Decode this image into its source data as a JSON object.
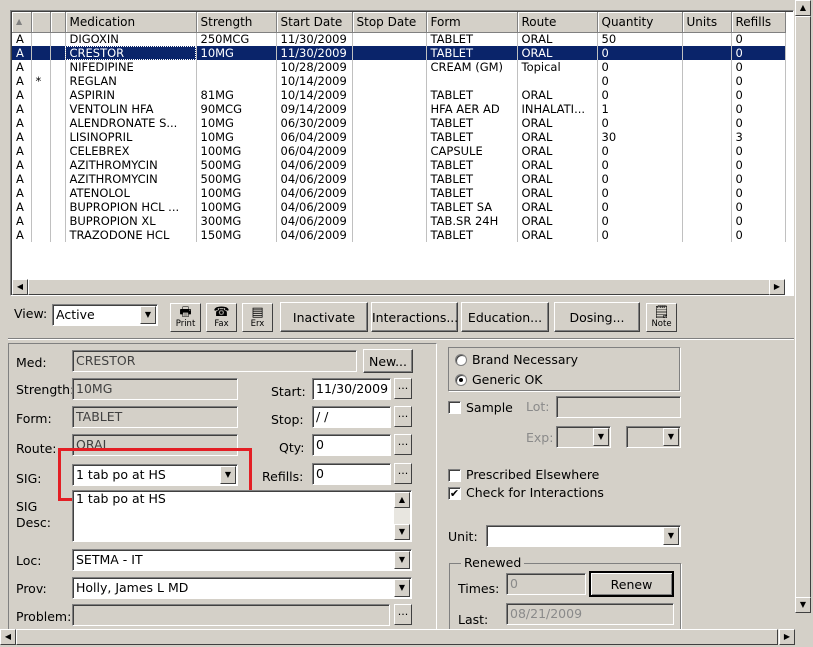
{
  "grid": {
    "columns": [
      "",
      "",
      "",
      "Medication",
      "Strength",
      "Start Date",
      "Stop Date",
      "Form",
      "Route",
      "Quantity",
      "Units",
      "Refills"
    ],
    "rows": [
      [
        "A",
        "",
        "",
        "DIGOXIN",
        "250MCG",
        "11/30/2009",
        "",
        "TABLET",
        "ORAL",
        "50",
        "",
        "0"
      ],
      [
        "A",
        "",
        "",
        "CRESTOR",
        "10MG",
        "11/30/2009",
        "",
        "TABLET",
        "ORAL",
        "0",
        "",
        "0"
      ],
      [
        "A",
        "",
        "",
        "NIFEDIPINE",
        "",
        "10/28/2009",
        "",
        "CREAM (GM)",
        "Topical",
        "0",
        "",
        "0"
      ],
      [
        "A",
        "*",
        "",
        "REGLAN",
        "",
        "10/14/2009",
        "",
        "",
        "",
        "0",
        "",
        "0"
      ],
      [
        "A",
        "",
        "",
        "ASPIRIN",
        "81MG",
        "10/14/2009",
        "",
        "TABLET",
        "ORAL",
        "0",
        "",
        "0"
      ],
      [
        "A",
        "",
        "",
        "VENTOLIN HFA",
        "90MCG",
        "09/14/2009",
        "",
        "HFA AER AD",
        "INHALATI...",
        "1",
        "",
        "0"
      ],
      [
        "A",
        "",
        "",
        "ALENDRONATE S...",
        "10MG",
        "06/30/2009",
        "",
        "TABLET",
        "ORAL",
        "0",
        "",
        "0"
      ],
      [
        "A",
        "",
        "",
        "LISINOPRIL",
        "10MG",
        "06/04/2009",
        "",
        "TABLET",
        "ORAL",
        "30",
        "",
        "3"
      ],
      [
        "A",
        "",
        "",
        "CELEBREX",
        "100MG",
        "06/04/2009",
        "",
        "CAPSULE",
        "ORAL",
        "0",
        "",
        "0"
      ],
      [
        "A",
        "",
        "",
        "AZITHROMYCIN",
        "500MG",
        "04/06/2009",
        "",
        "TABLET",
        "ORAL",
        "0",
        "",
        "0"
      ],
      [
        "A",
        "",
        "",
        "AZITHROMYCIN",
        "500MG",
        "04/06/2009",
        "",
        "TABLET",
        "ORAL",
        "0",
        "",
        "0"
      ],
      [
        "A",
        "",
        "",
        "ATENOLOL",
        "100MG",
        "04/06/2009",
        "",
        "TABLET",
        "ORAL",
        "0",
        "",
        "0"
      ],
      [
        "A",
        "",
        "",
        "BUPROPION HCL ...",
        "100MG",
        "04/06/2009",
        "",
        "TABLET SA",
        "ORAL",
        "0",
        "",
        "0"
      ],
      [
        "A",
        "",
        "",
        "BUPROPION XL",
        "300MG",
        "04/06/2009",
        "",
        "TAB.SR 24H",
        "ORAL",
        "0",
        "",
        "0"
      ],
      [
        "A",
        "",
        "",
        "TRAZODONE HCL",
        "150MG",
        "04/06/2009",
        "",
        "TABLET",
        "ORAL",
        "0",
        "",
        "0"
      ]
    ],
    "selected_row": 1
  },
  "toolbar": {
    "view_label": "View:",
    "view_value": "Active",
    "print": "Print",
    "fax": "Fax",
    "erx": "Erx",
    "inactivate": "Inactivate",
    "interactions": "Interactions...",
    "education": "Education...",
    "dosing": "Dosing...",
    "note": "Note"
  },
  "detail": {
    "med_label": "Med:",
    "med_value": "CRESTOR",
    "new_button": "New...",
    "strength_label": "Strength:",
    "strength_value": "10MG",
    "form_label": "Form:",
    "form_value": "TABLET",
    "route_label": "Route:",
    "route_value": "ORAL",
    "sig_label": "SIG:",
    "sig_value": "1 tab po at HS",
    "sig_desc_label_1": "SIG",
    "sig_desc_label_2": "Desc:",
    "sig_desc_value": "1 tab po at HS",
    "loc_label": "Loc:",
    "loc_value": "SETMA - IT",
    "prov_label": "Prov:",
    "prov_value": "Holly, James  L MD",
    "problem_label": "Problem:",
    "problem_value": "",
    "start_label": "Start:",
    "start_value": "11/30/2009",
    "stop_label": "Stop:",
    "stop_value": " / /",
    "qty_label": "Qty:",
    "qty_value": "0",
    "refills_label": "Refills:",
    "refills_value": "0",
    "ellipsis": "..."
  },
  "right_panel": {
    "brand_necessary": "Brand Necessary",
    "generic_ok": "Generic OK",
    "sample": "Sample",
    "lot_label": "Lot:",
    "exp_label": "Exp:",
    "prescribed_elsewhere": "Prescribed Elsewhere",
    "check_interactions": "Check for Interactions",
    "unit_label": "Unit:",
    "renewed_title": "Renewed",
    "times_label": "Times:",
    "times_value": "0",
    "renew_button": "Renew",
    "last_label": "Last:",
    "last_value": "08/21/2009"
  },
  "colors": {
    "selection": "#0a246a",
    "highlight_box": "#e31e24",
    "face": "#d4d0c8"
  }
}
